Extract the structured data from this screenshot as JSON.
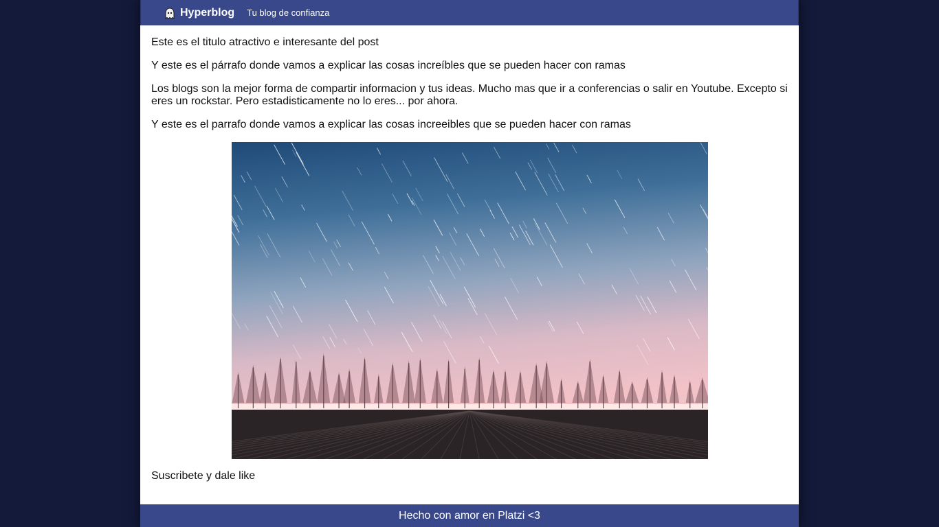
{
  "header": {
    "brand": "Hyperblog",
    "tagline": "Tu blog de confianza",
    "logo_icon": "ghost-icon"
  },
  "post": {
    "title": "Este es el titulo atractivo e interesante del post",
    "paragraph_1": "Y este es el párrafo donde vamos a explicar las cosas increíbles que se pueden hacer con ramas",
    "paragraph_2": "Los blogs son la mejor forma de compartir informacion y tus ideas. Mucho mas que ir a conferencias o salir en Youtube. Excepto si eres un rockstar. Pero estadisticamente no lo eres... por ahora.",
    "paragraph_3": "Y este es el parrafo donde vamos a explicar las cosas increeibles que se pueden hacer con ramas",
    "cta": "Suscribete y dale like"
  },
  "footer": {
    "text": "Hecho con amor en Platzi <3"
  },
  "colors": {
    "header_bg": "#38488a",
    "page_bg": "#131a3a",
    "content_bg": "#ffffff"
  }
}
